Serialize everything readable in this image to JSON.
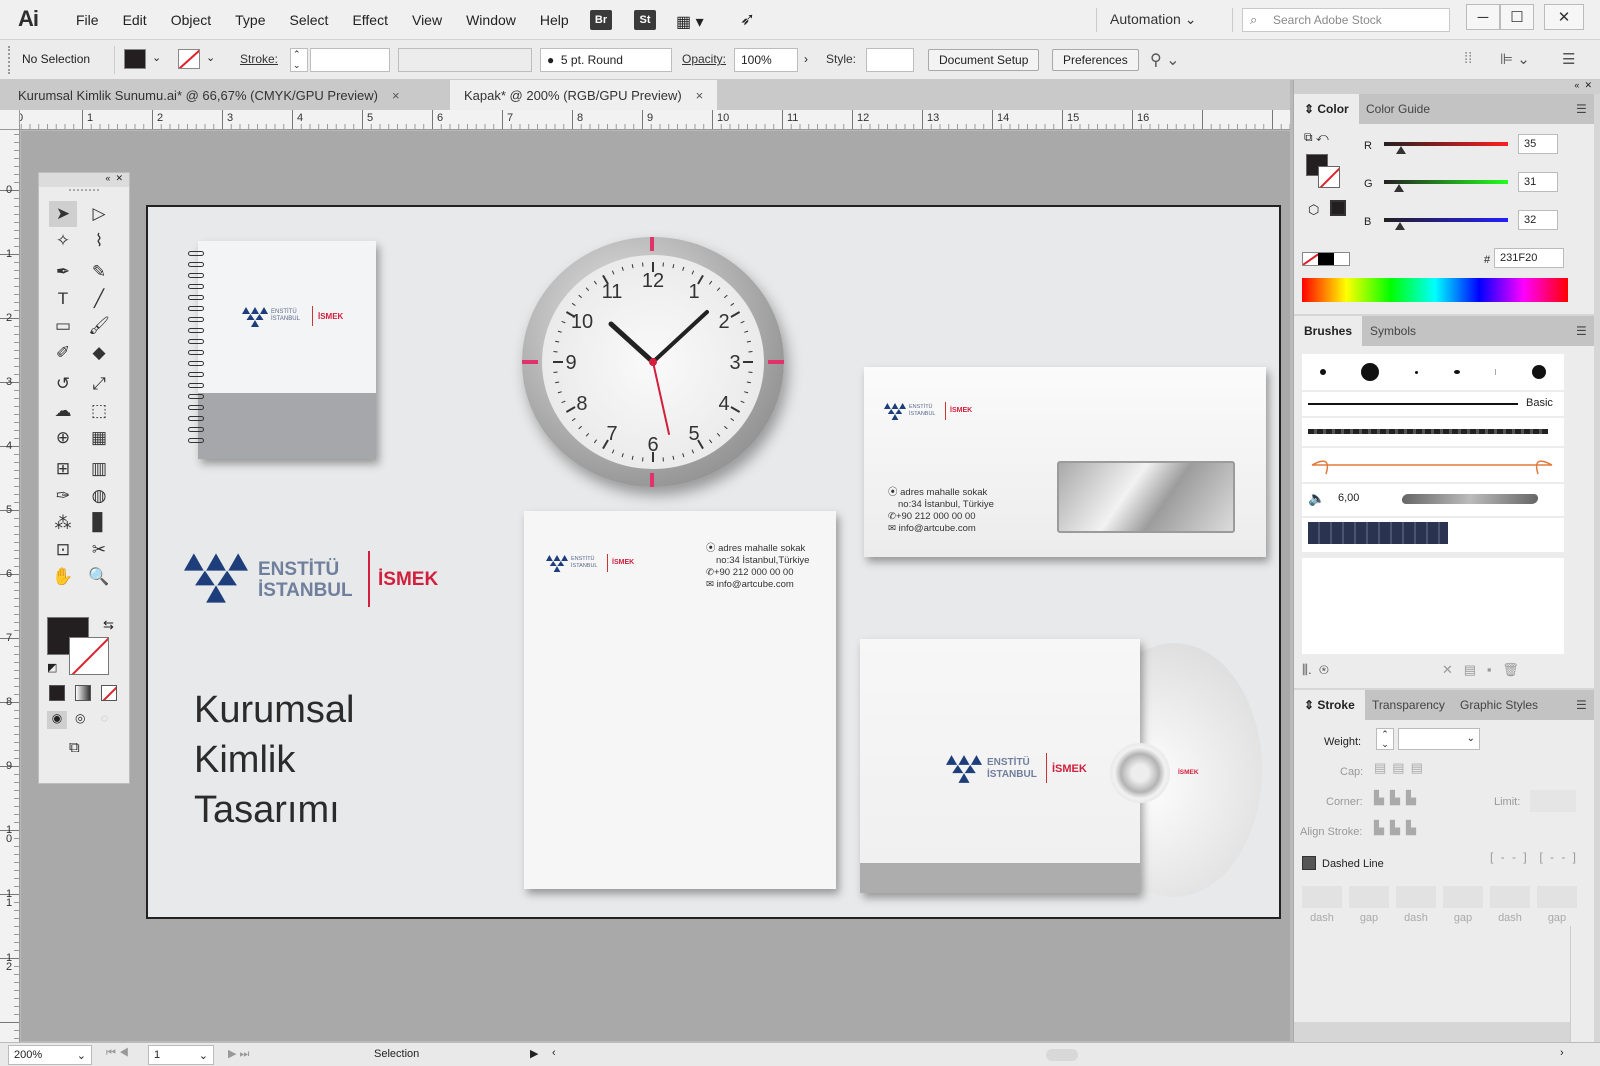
{
  "app": {
    "logo": "Ai",
    "menus": [
      "File",
      "Edit",
      "Object",
      "Type",
      "Select",
      "Effect",
      "View",
      "Window",
      "Help"
    ],
    "bridge": "Br",
    "stock": "St",
    "workspace": "Automation",
    "search_placeholder": "Search Adobe Stock"
  },
  "control": {
    "selection": "No Selection",
    "stroke_label": "Stroke:",
    "brush": "5 pt. Round",
    "opacity_label": "Opacity:",
    "opacity": "100%",
    "style_label": "Style:",
    "document_setup": "Document Setup",
    "preferences": "Preferences"
  },
  "tabs": [
    {
      "label": "Kurumsal Kimlik Sunumu.ai* @ 66,67% (CMYK/GPU Preview)",
      "close": "×"
    },
    {
      "label": "Kapak* @ 200% (RGB/GPU Preview)",
      "close": "×"
    }
  ],
  "ruler": {
    "h": [
      "0",
      "1",
      "2",
      "3",
      "4",
      "5",
      "6",
      "7",
      "8",
      "9",
      "10",
      "11",
      "12",
      "13",
      "14",
      "15",
      "16"
    ],
    "v": [
      "0",
      "1",
      "2",
      "3",
      "4",
      "5",
      "6",
      "7",
      "8",
      "9",
      "1\n0",
      "1\n1",
      "1\n2"
    ]
  },
  "artboard": {
    "brand_main": "ENSTİTÜ",
    "brand_sub": "İSTANBUL",
    "brand_red": "İSMEK",
    "title_lines": [
      "Kurumsal",
      "Kimlik",
      "Tasarımı"
    ],
    "contact": {
      "address1": "adres mahalle sokak",
      "address2_letter": "no:34 İstanbul,Türkiye",
      "address2_env": "no:34 İstanbul, Türkiye",
      "phone": "+90 212 000 00 00",
      "email": "info@artcube.com"
    },
    "clock_numbers": [
      "12",
      "1",
      "2",
      "3",
      "4",
      "5",
      "6",
      "7",
      "8",
      "9",
      "10",
      "11"
    ]
  },
  "color_panel": {
    "tabs": [
      "Color",
      "Color Guide"
    ],
    "r_label": "R",
    "g_label": "G",
    "b_label": "B",
    "r": "35",
    "g": "31",
    "b": "32",
    "r_level": 0.137,
    "g_level": 0.122,
    "b_level": 0.125,
    "hash": "#",
    "hex": "231F20",
    "fill": "#231F20"
  },
  "brushes_panel": {
    "tabs": [
      "Brushes",
      "Symbols"
    ],
    "basic": "Basic",
    "size": "6,00"
  },
  "stroke_panel": {
    "tabs": [
      "Stroke",
      "Transparency",
      "Graphic Styles"
    ],
    "weight": "Weight:",
    "cap": "Cap:",
    "corner": "Corner:",
    "limit": "Limit:",
    "align": "Align Stroke:",
    "dashed": "Dashed Line",
    "dash_labels": [
      "dash",
      "gap",
      "dash",
      "gap",
      "dash",
      "gap"
    ]
  },
  "status": {
    "zoom": "200%",
    "page": "1",
    "tool": "Selection"
  }
}
